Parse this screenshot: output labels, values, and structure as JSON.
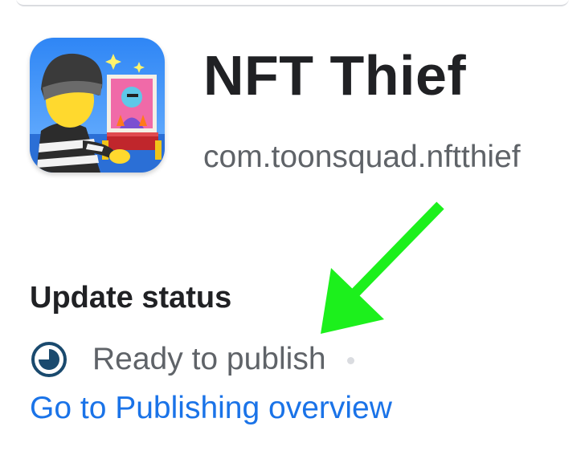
{
  "app": {
    "title": "NFT Thief",
    "package": "com.toonsquad.nftthief",
    "icon": "nft-thief-app-icon"
  },
  "update_status": {
    "heading": "Update status",
    "status_text": "Ready to publish",
    "status_icon": "pending-clock-icon",
    "link_text": "Go to Publishing overview"
  },
  "colors": {
    "title": "#202124",
    "secondary_text": "#5f6368",
    "link": "#1a73e8",
    "status_icon": "#1a4a6e",
    "annotation_arrow": "#1cf01c"
  }
}
